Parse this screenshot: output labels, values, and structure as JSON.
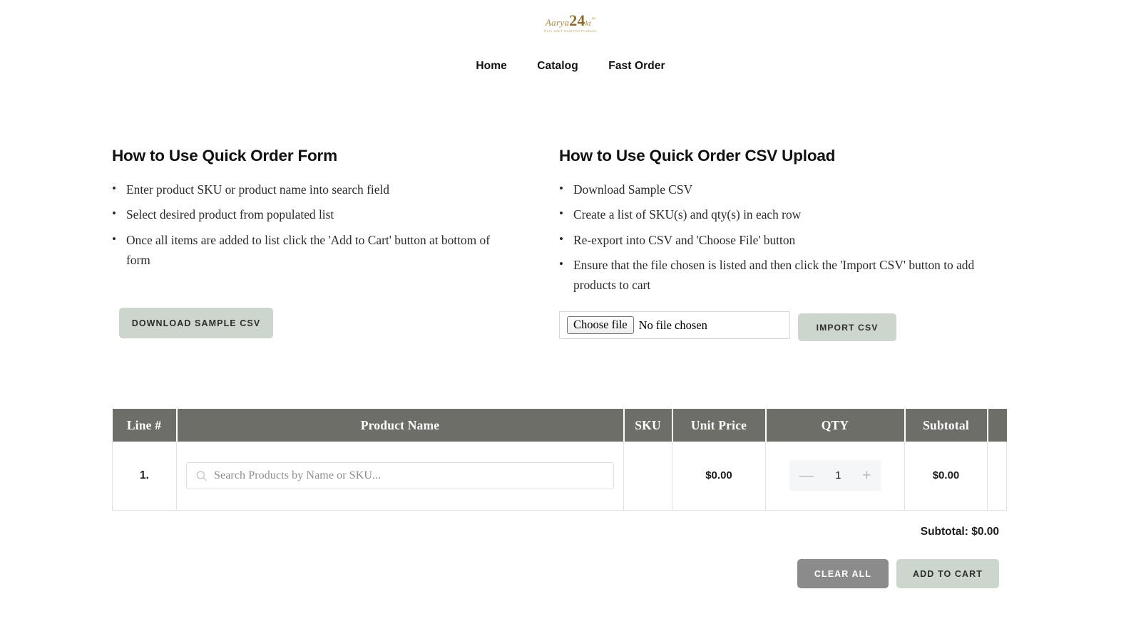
{
  "brand": {
    "name_word": "Aarya",
    "name_number": "24",
    "name_kt": "kt",
    "trademark": "™",
    "tagline": "Pure 24KT Gold Foil Products"
  },
  "nav": {
    "items": [
      {
        "label": "Home"
      },
      {
        "label": "Catalog"
      },
      {
        "label": "Fast Order"
      }
    ]
  },
  "instructions": {
    "form": {
      "title": "How to Use Quick Order Form",
      "steps": [
        "Enter product SKU or product name into search field",
        "Select desired product from populated list",
        "Once all items are added to list click the 'Add to Cart' button at bottom of form"
      ]
    },
    "csv": {
      "title": "How to Use Quick Order CSV Upload",
      "steps": [
        "Download Sample CSV",
        "Create a list of SKU(s) and qty(s) in each row",
        "Re-export into CSV and 'Choose File' button",
        "Ensure that the file chosen is listed and then click the 'Import CSV' button to add products to cart"
      ]
    }
  },
  "actions": {
    "download_sample_csv": "Download Sample CSV",
    "import_csv": "Import CSV",
    "clear_all": "Clear All",
    "add_to_cart": "Add to Cart"
  },
  "file_upload": {
    "choose_button": "Choose file",
    "status": "No file chosen"
  },
  "table": {
    "headers": {
      "line": "Line #",
      "product_name": "Product Name",
      "sku": "SKU",
      "unit_price": "Unit Price",
      "qty": "QTY",
      "subtotal": "Subtotal",
      "action": ""
    },
    "rows": [
      {
        "line": "1.",
        "search_placeholder": "Search Products by Name or SKU...",
        "sku": "",
        "unit_price": "$0.00",
        "qty": "1",
        "qty_decrement": "—",
        "qty_increment": "+",
        "subtotal": "$0.00"
      }
    ]
  },
  "totals": {
    "subtotal_label": "Subtotal: $0.00"
  },
  "colors": {
    "sage_button": "#ccd6cc",
    "gray_button": "#8b8b8b",
    "table_header": "#6e6e69",
    "logo_gold": "#b08d3f"
  }
}
